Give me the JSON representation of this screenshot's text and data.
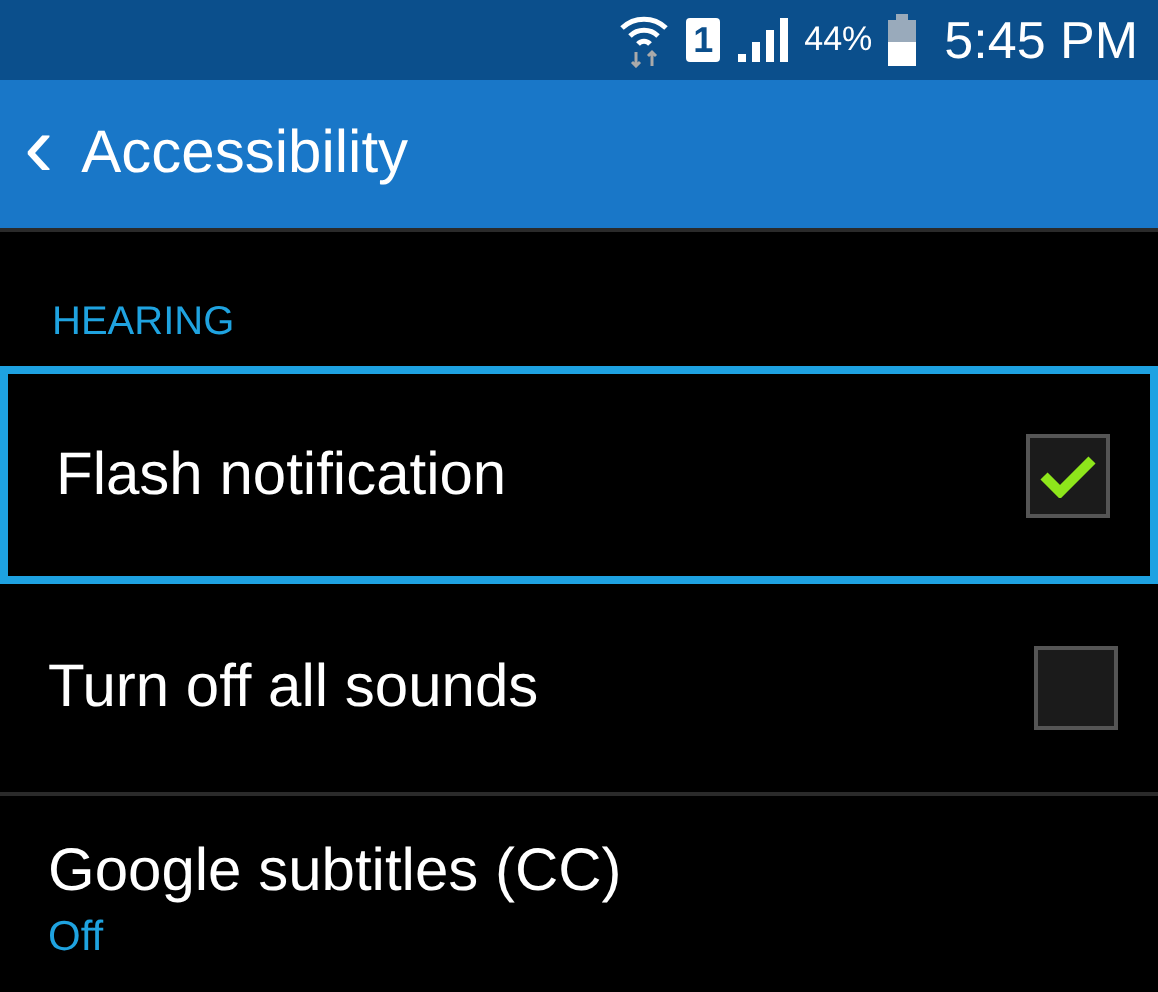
{
  "status_bar": {
    "battery": "44%",
    "time": "5:45 PM",
    "sim": "1"
  },
  "app_bar": {
    "back": "‹",
    "title": "Accessibility"
  },
  "section": {
    "title": "HEARING"
  },
  "items": [
    {
      "kind": "checkbox",
      "label": "Flash notification",
      "checked": true,
      "focused": true
    },
    {
      "kind": "checkbox",
      "label": "Turn off all sounds",
      "checked": false,
      "focused": false
    },
    {
      "kind": "summary",
      "label": "Google subtitles (CC)",
      "summary": "Off",
      "focused": false
    }
  ]
}
